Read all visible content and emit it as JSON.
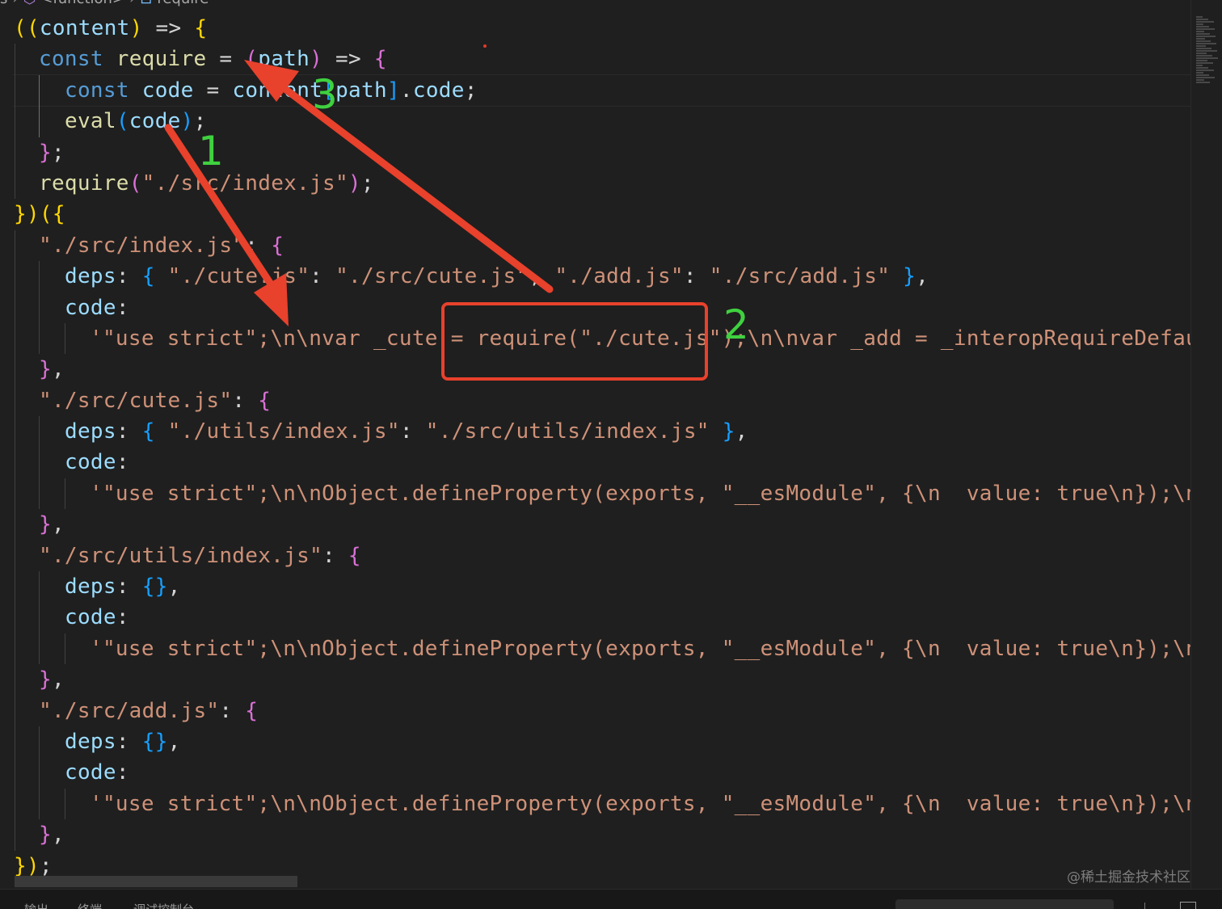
{
  "breadcrumb": {
    "items": [
      "s",
      "<function>",
      "require"
    ]
  },
  "code_lines": [
    {
      "id": "l1",
      "guides": [],
      "tokens": [
        [
          "brk1",
          "(("
        ],
        [
          "var",
          "content"
        ],
        [
          "brk1",
          ")"
        ],
        [
          "op",
          " => "
        ],
        [
          "brk1",
          "{"
        ]
      ]
    },
    {
      "id": "l2",
      "guides": [
        18
      ],
      "tokens": [
        [
          "kw",
          "const "
        ],
        [
          "fn",
          "require"
        ],
        [
          "op",
          " = "
        ],
        [
          "brk2",
          "("
        ],
        [
          "var",
          "path"
        ],
        [
          "brk2",
          ")"
        ],
        [
          "op",
          " => "
        ],
        [
          "brk2",
          "{"
        ]
      ]
    },
    {
      "id": "l3",
      "guides": [
        18,
        48
      ],
      "tokens": [
        [
          "kw",
          "const "
        ],
        [
          "var",
          "code"
        ],
        [
          "op",
          " = "
        ],
        [
          "var",
          "content"
        ],
        [
          "brk3",
          "["
        ],
        [
          "var",
          "path"
        ],
        [
          "brk3",
          "]"
        ],
        [
          "punc",
          "."
        ],
        [
          "prop",
          "code"
        ],
        [
          "punc",
          ";"
        ]
      ]
    },
    {
      "id": "l4",
      "guides": [
        18,
        48
      ],
      "tokens": [
        [
          "fn",
          "eval"
        ],
        [
          "brk3",
          "("
        ],
        [
          "var",
          "code"
        ],
        [
          "brk3",
          ")"
        ],
        [
          "punc",
          ";"
        ]
      ]
    },
    {
      "id": "l5",
      "guides": [
        18
      ],
      "tokens": [
        [
          "brk2",
          "}"
        ],
        [
          "punc",
          ";"
        ]
      ]
    },
    {
      "id": "l6",
      "guides": [
        18
      ],
      "tokens": [
        [
          "fn",
          "require"
        ],
        [
          "brk2",
          "("
        ],
        [
          "str",
          "\"./src/index.js\""
        ],
        [
          "brk2",
          ")"
        ],
        [
          "punc",
          ";"
        ]
      ]
    },
    {
      "id": "l7",
      "guides": [],
      "tokens": [
        [
          "brk1",
          "})({"
        ]
      ]
    },
    {
      "id": "l8",
      "guides": [
        18
      ],
      "tokens": [
        [
          "str",
          "\"./src/index.js\""
        ],
        [
          "punc",
          ": "
        ],
        [
          "brk2",
          "{"
        ]
      ]
    },
    {
      "id": "l9",
      "guides": [
        18,
        48
      ],
      "tokens": [
        [
          "prop",
          "deps"
        ],
        [
          "punc",
          ": "
        ],
        [
          "brk3",
          "{ "
        ],
        [
          "str",
          "\"./cute.js\""
        ],
        [
          "punc",
          ": "
        ],
        [
          "str",
          "\"./src/cute.js\""
        ],
        [
          "punc",
          ", "
        ],
        [
          "str",
          "\"./add.js\""
        ],
        [
          "punc",
          ": "
        ],
        [
          "str",
          "\"./src/add.js\""
        ],
        [
          "brk3",
          " }"
        ],
        [
          "punc",
          ","
        ]
      ]
    },
    {
      "id": "l10",
      "guides": [
        18,
        48
      ],
      "tokens": [
        [
          "prop",
          "code"
        ],
        [
          "punc",
          ":"
        ]
      ]
    },
    {
      "id": "l11",
      "guides": [
        18,
        48,
        80
      ],
      "tokens": [
        [
          "str",
          "'\"use strict\";\\n\\nvar _cute = require(\"./cute.js\");\\n\\nvar _add = _interopRequireDefault("
        ]
      ]
    },
    {
      "id": "l12",
      "guides": [
        18
      ],
      "tokens": [
        [
          "brk2",
          "}"
        ],
        [
          "punc",
          ","
        ]
      ]
    },
    {
      "id": "l13",
      "guides": [
        18
      ],
      "tokens": [
        [
          "str",
          "\"./src/cute.js\""
        ],
        [
          "punc",
          ": "
        ],
        [
          "brk2",
          "{"
        ]
      ]
    },
    {
      "id": "l14",
      "guides": [
        18,
        48
      ],
      "tokens": [
        [
          "prop",
          "deps"
        ],
        [
          "punc",
          ": "
        ],
        [
          "brk3",
          "{ "
        ],
        [
          "str",
          "\"./utils/index.js\""
        ],
        [
          "punc",
          ": "
        ],
        [
          "str",
          "\"./src/utils/index.js\""
        ],
        [
          "brk3",
          " }"
        ],
        [
          "punc",
          ","
        ]
      ]
    },
    {
      "id": "l15",
      "guides": [
        18,
        48
      ],
      "tokens": [
        [
          "prop",
          "code"
        ],
        [
          "punc",
          ":"
        ]
      ]
    },
    {
      "id": "l16",
      "guides": [
        18,
        48,
        80
      ],
      "tokens": [
        [
          "str",
          "'\"use strict\";\\n\\nObject.defineProperty(exports, \"__esModule\", {\\n  value: true\\n});\\nexp"
        ]
      ]
    },
    {
      "id": "l17",
      "guides": [
        18
      ],
      "tokens": [
        [
          "brk2",
          "}"
        ],
        [
          "punc",
          ","
        ]
      ]
    },
    {
      "id": "l18",
      "guides": [
        18
      ],
      "tokens": [
        [
          "str",
          "\"./src/utils/index.js\""
        ],
        [
          "punc",
          ": "
        ],
        [
          "brk2",
          "{"
        ]
      ]
    },
    {
      "id": "l19",
      "guides": [
        18,
        48
      ],
      "tokens": [
        [
          "prop",
          "deps"
        ],
        [
          "punc",
          ": "
        ],
        [
          "brk3",
          "{}"
        ],
        [
          "punc",
          ","
        ]
      ]
    },
    {
      "id": "l20",
      "guides": [
        18,
        48
      ],
      "tokens": [
        [
          "prop",
          "code"
        ],
        [
          "punc",
          ":"
        ]
      ]
    },
    {
      "id": "l21",
      "guides": [
        18,
        48,
        80
      ],
      "tokens": [
        [
          "str",
          "'\"use strict\";\\n\\nObject.defineProperty(exports, \"__esModule\", {\\n  value: true\\n});\\nexp"
        ]
      ]
    },
    {
      "id": "l22",
      "guides": [
        18
      ],
      "tokens": [
        [
          "brk2",
          "}"
        ],
        [
          "punc",
          ","
        ]
      ]
    },
    {
      "id": "l23",
      "guides": [
        18
      ],
      "tokens": [
        [
          "str",
          "\"./src/add.js\""
        ],
        [
          "punc",
          ": "
        ],
        [
          "brk2",
          "{"
        ]
      ]
    },
    {
      "id": "l24",
      "guides": [
        18,
        48
      ],
      "tokens": [
        [
          "prop",
          "deps"
        ],
        [
          "punc",
          ": "
        ],
        [
          "brk3",
          "{}"
        ],
        [
          "punc",
          ","
        ]
      ]
    },
    {
      "id": "l25",
      "guides": [
        18,
        48
      ],
      "tokens": [
        [
          "prop",
          "code"
        ],
        [
          "punc",
          ":"
        ]
      ]
    },
    {
      "id": "l26",
      "guides": [
        18,
        48,
        80
      ],
      "tokens": [
        [
          "str",
          "'\"use strict\";\\n\\nObject.defineProperty(exports, \"__esModule\", {\\n  value: true\\n});\\nexp"
        ]
      ]
    },
    {
      "id": "l27",
      "guides": [
        18
      ],
      "tokens": [
        [
          "brk2",
          "}"
        ],
        [
          "punc",
          ","
        ]
      ]
    },
    {
      "id": "l28",
      "guides": [],
      "tokens": [
        [
          "brk1",
          "})"
        ],
        [
          "punc",
          ";"
        ]
      ]
    }
  ],
  "annotations": {
    "labels": [
      "1",
      "2",
      "3"
    ],
    "arrow_color": "#e8412c",
    "box_color": "#e8412c",
    "label_color": "#3fd13f"
  },
  "panel": {
    "tabs": [
      "输出",
      "终端",
      "调试控制台"
    ]
  },
  "watermark": "@稀土掘金技术社区"
}
